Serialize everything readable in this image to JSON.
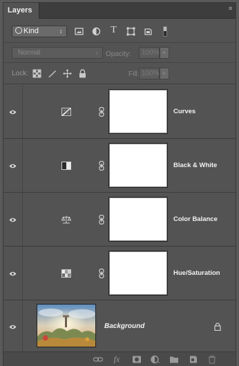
{
  "panel": {
    "tab_label": "Layers",
    "menu_glyph": "≡"
  },
  "filter": {
    "kind_label": "Kind",
    "kind_arrows": "↕",
    "type_glyph": "T",
    "icons": [
      "pixel-layer-filter-icon",
      "adjustment-layer-filter-icon",
      "type-layer-filter-icon",
      "shape-layer-filter-icon",
      "smart-object-filter-icon"
    ]
  },
  "blend": {
    "mode": "Normal",
    "arrows": "↕",
    "opacity_label": "Opacity:",
    "opacity_value": "100%",
    "dropdown_glyph": "▸"
  },
  "lock": {
    "label": "Lock:",
    "fill_label": "Fill:",
    "fill_value": "100%",
    "dropdown_glyph": "▸",
    "icons": [
      "lock-transparent-pixels-icon",
      "lock-image-pixels-icon",
      "lock-position-icon",
      "lock-all-icon"
    ]
  },
  "layers": [
    {
      "name": "Curves",
      "icon": "curves-adjustment-icon",
      "visible": true
    },
    {
      "name": "Black & White",
      "icon": "black-white-adjustment-icon",
      "visible": true
    },
    {
      "name": "Color Balance",
      "icon": "color-balance-adjustment-icon",
      "visible": true
    },
    {
      "name": "Hue/Saturation",
      "icon": "hue-saturation-adjustment-icon",
      "visible": true
    }
  ],
  "background_layer": {
    "name": "Background",
    "visible": true,
    "locked": true
  },
  "footer": {
    "fx_label": "fx",
    "icons": [
      "link-layers-icon",
      "layer-style-icon",
      "add-mask-icon",
      "new-adjustment-icon",
      "new-group-icon",
      "new-layer-icon",
      "delete-layer-icon"
    ]
  },
  "colors": {
    "panel_bg": "#535353",
    "tab_bg": "#3d3d3d",
    "text": "#f2f2f2",
    "muted": "#8a8a8a"
  }
}
